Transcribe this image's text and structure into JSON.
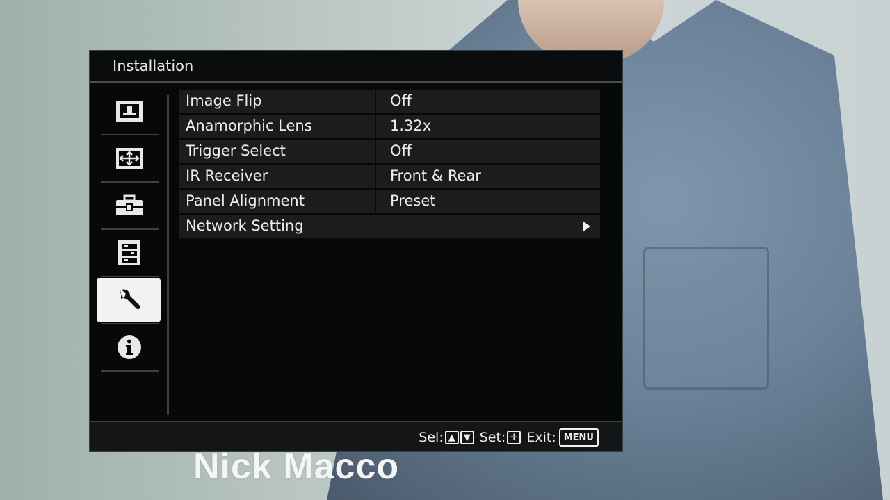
{
  "background": {
    "caption": "Nick Macco"
  },
  "menu": {
    "title": "Installation",
    "icons": [
      {
        "name": "picture-icon",
        "selected": false
      },
      {
        "name": "signal-icon",
        "selected": false
      },
      {
        "name": "toolbox-icon",
        "selected": false
      },
      {
        "name": "memory-icon",
        "selected": false
      },
      {
        "name": "wrench-icon",
        "selected": true
      },
      {
        "name": "info-icon",
        "selected": false
      }
    ],
    "rows": [
      {
        "label": "Image Flip",
        "value": "Off"
      },
      {
        "label": "Anamorphic Lens",
        "value": "1.32x"
      },
      {
        "label": "Trigger Select",
        "value": "Off"
      },
      {
        "label": "IR Receiver",
        "value": "Front & Rear"
      },
      {
        "label": "Panel Alignment",
        "value": "Preset"
      },
      {
        "label": "Network Setting",
        "value": ""
      }
    ],
    "footer": {
      "sel_label": "Sel:",
      "set_label": "Set:",
      "exit_label": "Exit:",
      "menu_key": "MENU"
    }
  },
  "colors": {
    "osd_background": "#070808",
    "row_background": "#1b1c1d",
    "selected_icon_background": "#f2f2f2",
    "text": "#eceeee"
  }
}
